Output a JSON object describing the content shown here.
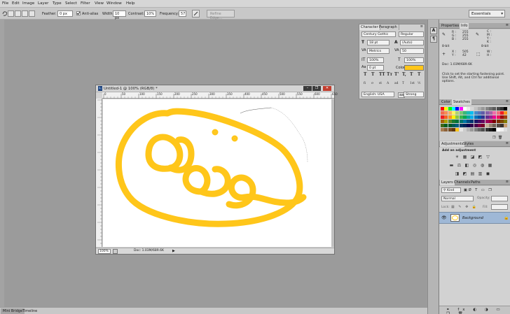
{
  "menu": [
    "File",
    "Edit",
    "Image",
    "Layer",
    "Type",
    "Select",
    "Filter",
    "View",
    "Window",
    "Help"
  ],
  "options": {
    "feather_label": "Feather:",
    "feather_value": "0 px",
    "antialias_label": "Anti-alias",
    "width_label": "Width:",
    "width_value": "10 px",
    "contrast_label": "Contrast:",
    "contrast_value": "10%",
    "frequency_label": "Frequency:",
    "frequency_value": "57",
    "refine_edge_label": "Refine Edge...",
    "workspace_value": "Essentials"
  },
  "document": {
    "title": "Untitled-1 @ 100% (RGB/8) *",
    "min_label": "–",
    "max_label": "❐",
    "close_label": "✕",
    "ruler_ticks": [
      "0",
      "50",
      "100",
      "150",
      "200",
      "250",
      "300",
      "350",
      "400",
      "450",
      "500",
      "550",
      "600",
      "650"
    ],
    "zoom_value": "100%",
    "doc_info": "Doc: 1.03M/689.6K",
    "stroke_color": "#FFC61A"
  },
  "bottom_tabs": [
    "Mini Bridge",
    "Timeline"
  ],
  "right_strip_icons": [
    "A",
    "¶"
  ],
  "character": {
    "tabs": [
      "Character",
      "Paragraph"
    ],
    "font_family": "Century Gothic",
    "font_style": "Regular",
    "font_size": "18 pt",
    "leading": "(Auto)",
    "kerning": "Metrics",
    "tracking": "50",
    "vertical_scale": "100%",
    "horizontal_scale": "100%",
    "baseline_shift": "0 pt",
    "color_label": "Color:",
    "color_value": "#FFC61A",
    "type_buttons": [
      "T",
      "T",
      "TT",
      "Tт",
      "T'",
      "T,",
      "T",
      "T"
    ],
    "ot_buttons": [
      "fi",
      "ơ",
      "st",
      "A",
      "ad",
      "T",
      "1st",
      "½"
    ],
    "language": "English: USA",
    "aa_label": "aa",
    "antialias": "Strong"
  },
  "info": {
    "tabs": [
      "Properties",
      "Info"
    ],
    "rgb_labels": [
      "R :",
      "G :",
      "B :"
    ],
    "rgb_values": [
      "255",
      "255",
      "255"
    ],
    "cmyk_labels": [
      "C :",
      "M :",
      "Y :",
      "K :"
    ],
    "bit_left": "8-bit",
    "bit_right": "8-bit",
    "x_label": "X :",
    "x_value": "505",
    "y_label": "Y :",
    "y_value": "42",
    "w_label": "W :",
    "h_label": "H :",
    "doc_info": "Doc: 1.03M/689.6K",
    "hint": [
      "Click to set the starting fastening point.",
      "Use Shift, Alt, and Ctrl for additional",
      "options."
    ]
  },
  "swatches": {
    "tabs": [
      "Color",
      "Swatches"
    ]
  },
  "adjustments": {
    "tabs": [
      "Adjustments",
      "Styles"
    ],
    "heading": "Add an adjustment"
  },
  "layers": {
    "tabs": [
      "Layers",
      "Channels",
      "Paths"
    ],
    "filter_label": "Kind",
    "blend_mode": "Normal",
    "opacity_label": "Opacity:",
    "lock_label": "Lock:",
    "fill_label": "Fill:",
    "items": [
      {
        "name": "Background",
        "visible": true,
        "locked": true
      }
    ]
  }
}
